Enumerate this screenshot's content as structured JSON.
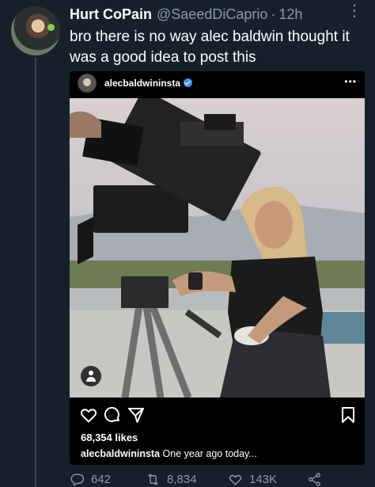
{
  "tweet": {
    "display_name": "Hurt CoPain",
    "handle": "@SaeedDiCaprio",
    "separator": "·",
    "time": "12h",
    "text": "bro there is no way alec baldwin thought it was a good idea to post this"
  },
  "instagram_embed": {
    "username": "alecbaldwininsta",
    "more_label": "•••",
    "likes": "68,354 likes",
    "caption_user": "alecbaldwininsta",
    "caption_text": "One year ago today..."
  },
  "stats": {
    "replies": "642",
    "retweets": "8,834",
    "likes": "143K"
  },
  "icons": {
    "tweet_more": "more-dots-icon",
    "verified": "verified-badge-icon",
    "ig_like": "heart-outline-icon",
    "ig_comment": "comment-bubble-icon",
    "ig_share": "paper-plane-icon",
    "ig_save": "bookmark-icon",
    "ig_tag": "user-tag-icon",
    "reply": "reply-icon",
    "retweet": "retweet-icon",
    "like": "heart-icon",
    "share": "share-icon"
  },
  "colors": {
    "background": "#15202b",
    "secondary_text": "#8b98a5",
    "thread_line": "#38444d",
    "verified_blue": "#3897f0"
  }
}
